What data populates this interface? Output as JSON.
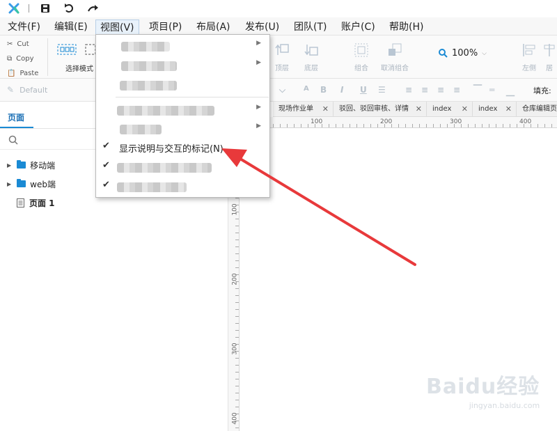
{
  "menubar": {
    "items": [
      "文件(F)",
      "编辑(E)",
      "视图(V)",
      "项目(P)",
      "布局(A)",
      "发布(U)",
      "团队(T)",
      "账户(C)",
      "帮助(H)"
    ]
  },
  "clipboard": {
    "cut": "Cut",
    "copy": "Copy",
    "paste": "Paste"
  },
  "toolbar": {
    "select_mode": "选择模式",
    "top": "顶层",
    "bottom": "底层",
    "group": "组合",
    "ungroup": "取消组合",
    "zoom": "100%",
    "left": "左侧",
    "cut_off": "居"
  },
  "formatbar": {
    "style_default": "Default",
    "fill_label": "填充:"
  },
  "pages_panel": {
    "title": "页面",
    "items": [
      {
        "label": "移动端",
        "type": "folder"
      },
      {
        "label": "web端",
        "type": "folder"
      },
      {
        "label": "页面 1",
        "type": "page"
      }
    ]
  },
  "doc_tabs": [
    "现场作业单",
    "驳回、驳回审核、详情",
    "index",
    "index",
    "仓库编辑页"
  ],
  "rulers": {
    "horizontal": [
      "100",
      "200",
      "300",
      "400"
    ],
    "vertical": [
      "100",
      "200",
      "300",
      "400"
    ]
  },
  "view_menu": {
    "checked_item": "显示说明与交互的标记(N)"
  },
  "watermark": {
    "brand": "Baidu经验",
    "url": "jingyan.baidu.com"
  },
  "colors": {
    "accent": "#1a8ad4",
    "arrow": "#e8393b",
    "blue_icon": "#1a8ad4"
  }
}
